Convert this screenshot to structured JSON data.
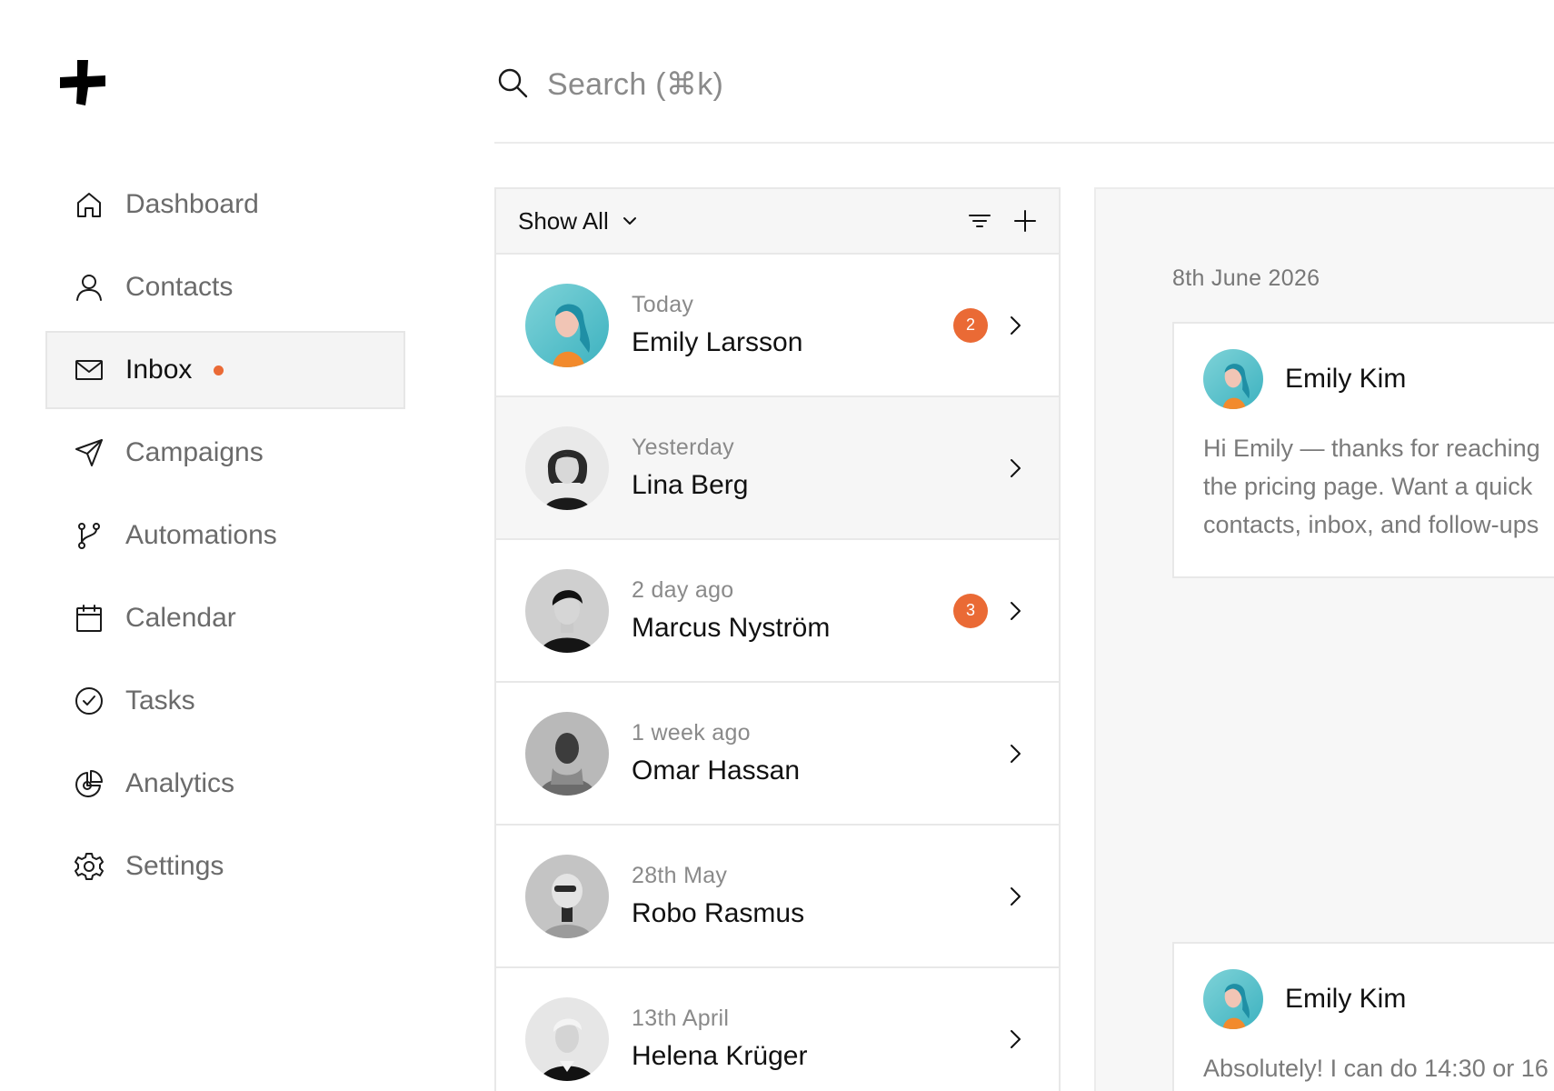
{
  "app": {
    "logo": "plus-cross-logo"
  },
  "sidebar": {
    "items": [
      {
        "label": "Dashboard",
        "icon": "home-icon"
      },
      {
        "label": "Contacts",
        "icon": "user-icon"
      },
      {
        "label": "Inbox",
        "icon": "mail-icon",
        "active": true,
        "unread": true
      },
      {
        "label": "Campaigns",
        "icon": "send-icon"
      },
      {
        "label": "Automations",
        "icon": "branch-icon"
      },
      {
        "label": "Calendar",
        "icon": "calendar-icon"
      },
      {
        "label": "Tasks",
        "icon": "check-circle-icon"
      },
      {
        "label": "Analytics",
        "icon": "pie-chart-icon"
      },
      {
        "label": "Settings",
        "icon": "gear-icon"
      }
    ]
  },
  "search": {
    "placeholder": "Search (⌘k)"
  },
  "inbox": {
    "filter_label": "Show All",
    "threads": [
      {
        "when": "Today",
        "name": "Emily Larsson",
        "unread": "2"
      },
      {
        "when": "Yesterday",
        "name": "Lina Berg",
        "unread": ""
      },
      {
        "when": "2 day ago",
        "name": "Marcus Nyström",
        "unread": "3"
      },
      {
        "when": "1 week ago",
        "name": "Omar Hassan",
        "unread": ""
      },
      {
        "when": "28th May",
        "name": "Robo Rasmus",
        "unread": ""
      },
      {
        "when": "13th April",
        "name": "Helena Krüger",
        "unread": ""
      }
    ]
  },
  "conversation": {
    "date": "8th June 2026",
    "messages": [
      {
        "author": "Emily Kim",
        "lines": [
          "Hi Emily — thanks for reaching",
          "the pricing page. Want a quick",
          "contacts, inbox, and follow-ups"
        ]
      },
      {
        "author": "Emily Kim",
        "lines": [
          "Absolutely! I can do 14:30 or 16"
        ]
      }
    ]
  },
  "colors": {
    "accent": "#ea6a35",
    "muted_text": "#8a8a8a",
    "border": "#e8e8e8"
  }
}
